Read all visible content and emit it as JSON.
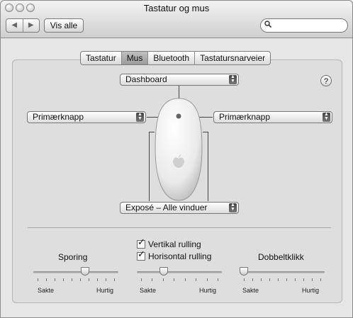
{
  "window": {
    "title": "Tastatur og mus"
  },
  "toolbar": {
    "back_label": "◀",
    "forward_label": "▶",
    "show_all_label": "Vis alle",
    "search_value": ""
  },
  "tabs": [
    {
      "label": "Tastatur",
      "active": false
    },
    {
      "label": "Mus",
      "active": true
    },
    {
      "label": "Bluetooth",
      "active": false
    },
    {
      "label": "Tastatursnarveier",
      "active": false
    }
  ],
  "mouse": {
    "top_button": "Dashboard",
    "left_button": "Primærknapp",
    "right_button": "Primærknapp",
    "bottom_button": "Exposé – Alle vinduer",
    "help_label": "?"
  },
  "scrolling": {
    "vertical_label": "Vertikal rulling",
    "vertical_checked": true,
    "horizontal_label": "Horisontal rulling",
    "horizontal_checked": true
  },
  "sliders": {
    "tracking": {
      "label": "Sporing",
      "min_label": "Sakte",
      "max_label": "Hurtig",
      "value": 0.62,
      "ticks": 10
    },
    "scroll": {
      "label": "",
      "min_label": "Sakte",
      "max_label": "Hurtig",
      "value": 0.3,
      "ticks": 8
    },
    "double_click": {
      "label": "Dobbeltklikk",
      "min_label": "Sakte",
      "max_label": "Hurtig",
      "value": 0.0,
      "ticks": 10
    }
  },
  "colors": {
    "window_bg": "#e6e6e6",
    "panel_bg": "#dedede"
  }
}
